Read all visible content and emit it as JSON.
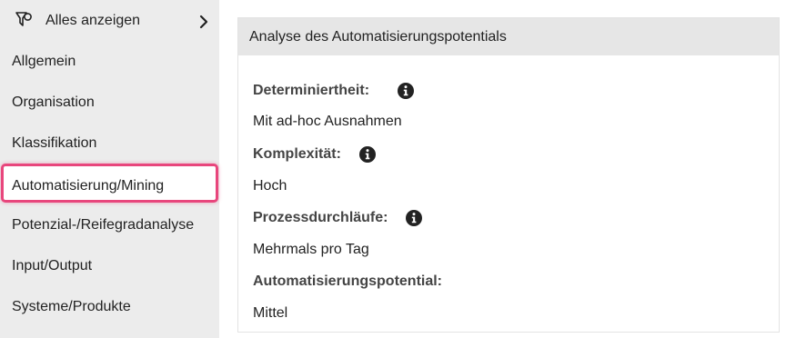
{
  "sidebar": {
    "show_all_label": "Alles anzeigen",
    "items": [
      {
        "label": "Allgemein"
      },
      {
        "label": "Organisation"
      },
      {
        "label": "Klassifikation"
      },
      {
        "label": "Automatisierung/Mining"
      },
      {
        "label": "Potenzial-/Reifegradanalyse"
      },
      {
        "label": "Input/Output"
      },
      {
        "label": "Systeme/Produkte"
      }
    ],
    "active_item": "Automatisierung/Mining"
  },
  "panel": {
    "title": "Analyse des Automatisierungspotentials",
    "fields": [
      {
        "label": "Determiniertheit:",
        "value": "Mit ad-hoc Ausnahmen",
        "has_info": true
      },
      {
        "label": "Komplexität:",
        "value": "Hoch",
        "has_info": true
      },
      {
        "label": "Prozessdurchläufe:",
        "value": "Mehrmals pro Tag",
        "has_info": true
      },
      {
        "label": "Automatisierungspotential:",
        "value": "Mittel",
        "has_info": false
      }
    ]
  },
  "colors": {
    "sidebar_bg": "#ececec",
    "active_border": "#e8467c",
    "panel_header_bg": "#e6e6e6"
  },
  "icons": {
    "show_all": "filter-icon",
    "show_all_arrow": "chevron-right-icon",
    "field_info": "info-icon"
  }
}
